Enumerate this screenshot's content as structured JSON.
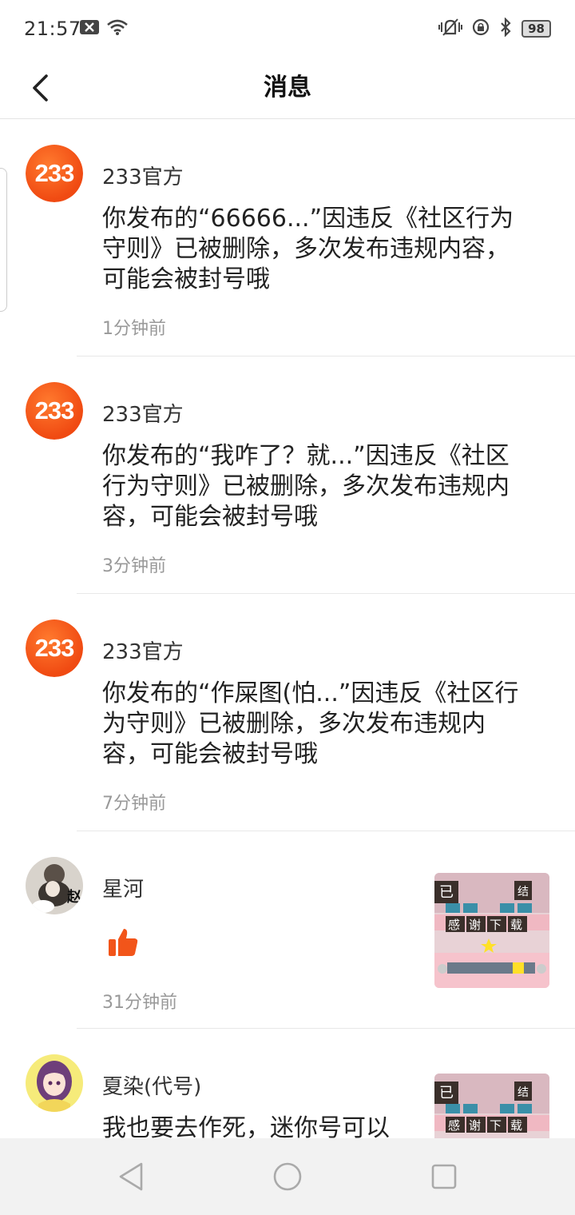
{
  "status": {
    "time": "21:57",
    "battery": "98"
  },
  "header": {
    "title": "消息"
  },
  "messages": [
    {
      "sender": "233官方",
      "content": "你发布的“66666...”因违反《社区行为守则》已被删除，多次发布违规内容，可能会被封号哦",
      "time": "1分钟前",
      "avatar_text": "233"
    },
    {
      "sender": "233官方",
      "content": "你发布的“我咋了？就...”因违反《社区行为守则》已被删除，多次发布违规内容，可能会被封号哦",
      "time": "3分钟前",
      "avatar_text": "233"
    },
    {
      "sender": "233官方",
      "content": "你发布的“作屎图(怕...”因违反《社区行为守则》已被删除，多次发布违规内容，可能会被封号哦",
      "time": "7分钟前",
      "avatar_text": "233"
    },
    {
      "sender": "星河",
      "content_icon": "thumbs-up-icon",
      "time": "31分钟前",
      "avatar_text": "赵"
    },
    {
      "sender": "夏染(代号)",
      "content": "我也要去作死，迷你号可以"
    }
  ],
  "thumbnail": {
    "row1": [
      "已",
      "结"
    ],
    "row2": [
      "感",
      "谢",
      "下",
      "载"
    ]
  },
  "colors": {
    "accent": "#f0551c",
    "like": "#f2551a"
  }
}
